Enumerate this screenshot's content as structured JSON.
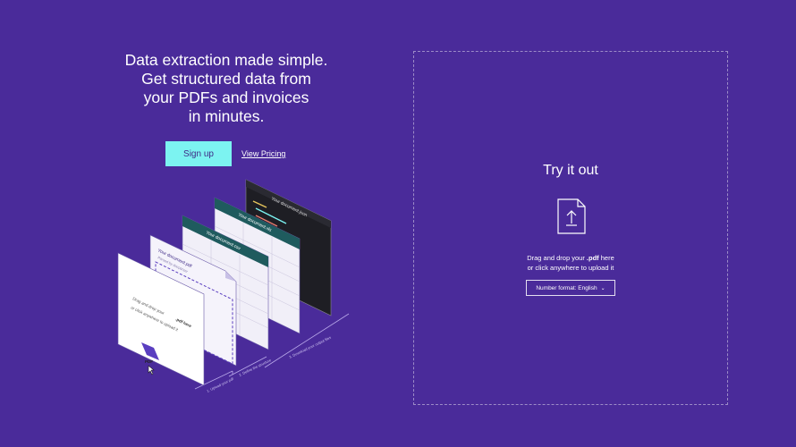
{
  "hero": {
    "headline_lines": [
      "Data extraction made simple.",
      "Get structured data from",
      "your PDFs and invoices",
      "in minutes."
    ],
    "signup_label": "Sign up",
    "pricing_label": "View Pricing"
  },
  "illustration": {
    "doc_title": "Your document.pdf",
    "doc_subtitle": "Parsed by docparser",
    "drag_text_1": "Drag and drop your",
    "drag_text_2": ".pdf here",
    "drag_text_3": "or click anywhere to upload it",
    "pdf_badge": "PDF",
    "csv_title": "Your document.csv",
    "xls_title": "Your document.xls",
    "json_title": "Your document.json",
    "step_1": "1. Upload your pdf",
    "step_2": "2. Define the structure",
    "step_3": "3. Download your output files"
  },
  "upload": {
    "title": "Try it out",
    "hint_prefix": "Drag and drop your ",
    "hint_ext": ".pdf",
    "hint_suffix": " here",
    "hint_line2": "or click anywhere to upload it",
    "format_label": "Number format: English",
    "format_chevron": "⌄"
  },
  "colors": {
    "background": "#4a2b9a",
    "accent": "#7cf3f1",
    "teal": "#1f5b5e",
    "dark": "#1e1e24"
  },
  "icons": {
    "upload": "file-upload-icon",
    "cursor": "cursor-icon"
  }
}
